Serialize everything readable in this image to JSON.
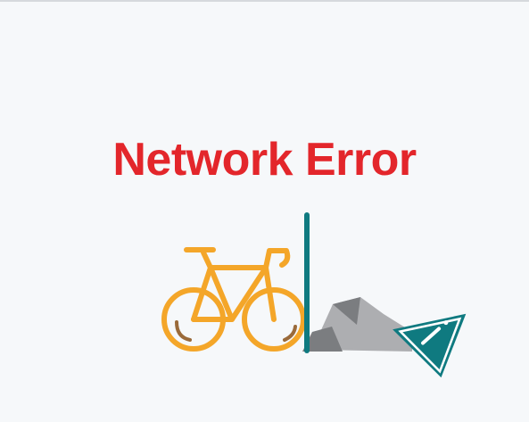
{
  "error": {
    "title": "Network Error"
  },
  "colors": {
    "title": "#e3262b",
    "bicycle": "#f4a629",
    "bicycle_shadow": "#9a6a3a",
    "pole": "#0f7a80",
    "rock_light": "#adaeb1",
    "rock_dark": "#7b7d80",
    "sign": "#0f7a80",
    "sign_detail": "#ffffff",
    "background": "#f6f8fa"
  },
  "icons": {
    "bicycle": "bicycle-icon",
    "pole": "barrier-pole-icon",
    "rock": "rock-icon",
    "sign": "warning-sign-icon"
  }
}
